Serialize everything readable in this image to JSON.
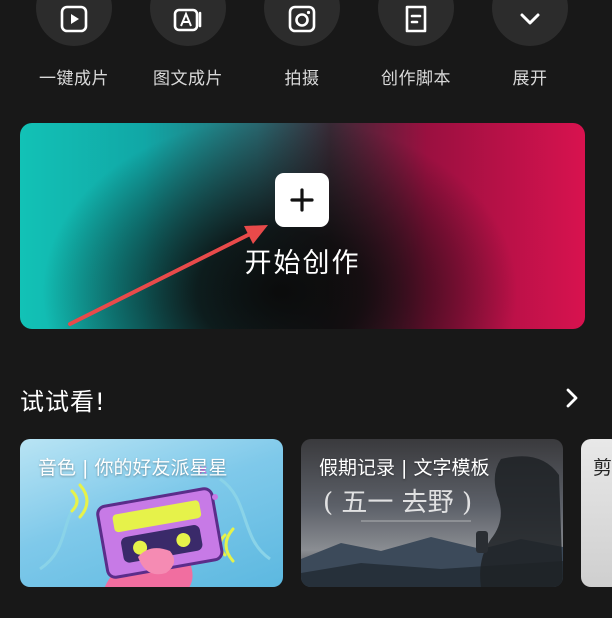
{
  "quick_actions": [
    {
      "label": "一键成片",
      "icon": "play-square-icon"
    },
    {
      "label": "图文成片",
      "icon": "text-image-icon"
    },
    {
      "label": "拍摄",
      "icon": "camera-icon"
    },
    {
      "label": "创作脚本",
      "icon": "script-doc-icon"
    },
    {
      "label": "展开",
      "icon": "chevron-down-icon"
    }
  ],
  "hero": {
    "label": "开始创作",
    "icon": "plus-icon"
  },
  "section": {
    "title": "试试看!",
    "more_icon": "chevron-right-icon"
  },
  "cards": [
    {
      "title": "音色 | 你的好友派星星"
    },
    {
      "title": "假期记录 | 文字模板"
    },
    {
      "title": "剪"
    }
  ],
  "colors": {
    "background": "#181818",
    "hero_left": "#12c2b6",
    "hero_right": "#d8124f",
    "annotation_arrow": "#e84a4a"
  }
}
